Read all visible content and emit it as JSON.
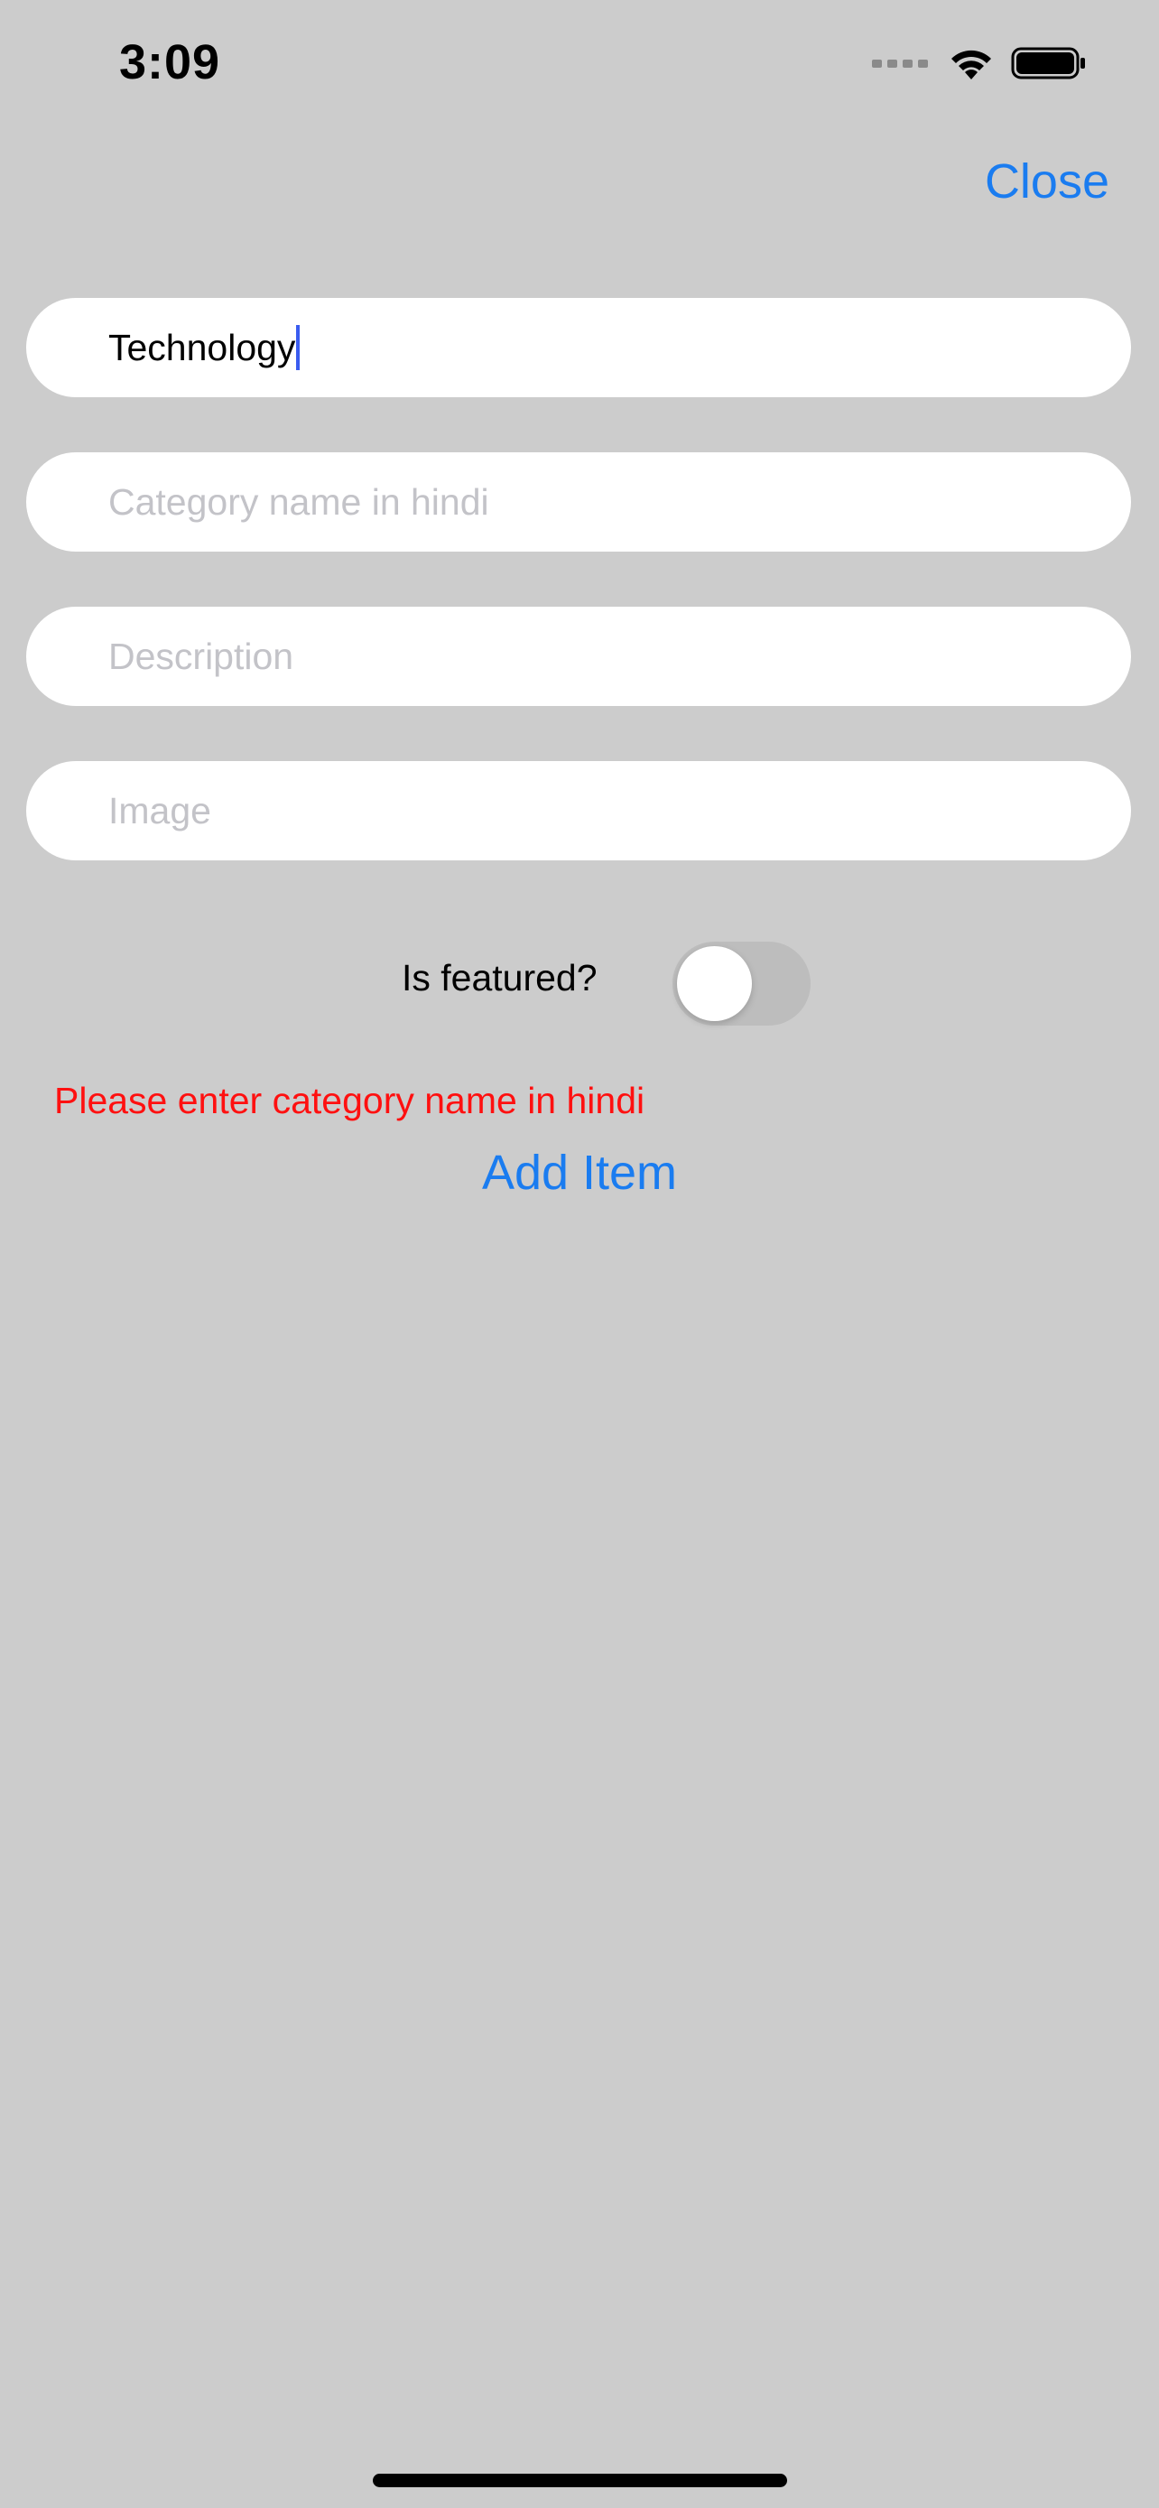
{
  "status_bar": {
    "time": "3:09",
    "icons": [
      "cellular-signal-icon",
      "wifi-icon",
      "battery-icon"
    ]
  },
  "header": {
    "close_label": "Close"
  },
  "form": {
    "category_name": {
      "value": "Technology",
      "placeholder": ""
    },
    "category_name_hindi": {
      "value": "",
      "placeholder": "Category name in hindi"
    },
    "description": {
      "value": "",
      "placeholder": "Description"
    },
    "image": {
      "value": "",
      "placeholder": "Image"
    },
    "featured": {
      "label": "Is featured?",
      "on": false
    },
    "error_message": "Please enter category name in hindi",
    "submit_label": "Add Item"
  },
  "colors": {
    "background": "#cccccc",
    "accent": "#1a7cf0",
    "error": "#ff1010",
    "field": "#ffffff",
    "toggle_off": "#bdbdbd"
  }
}
